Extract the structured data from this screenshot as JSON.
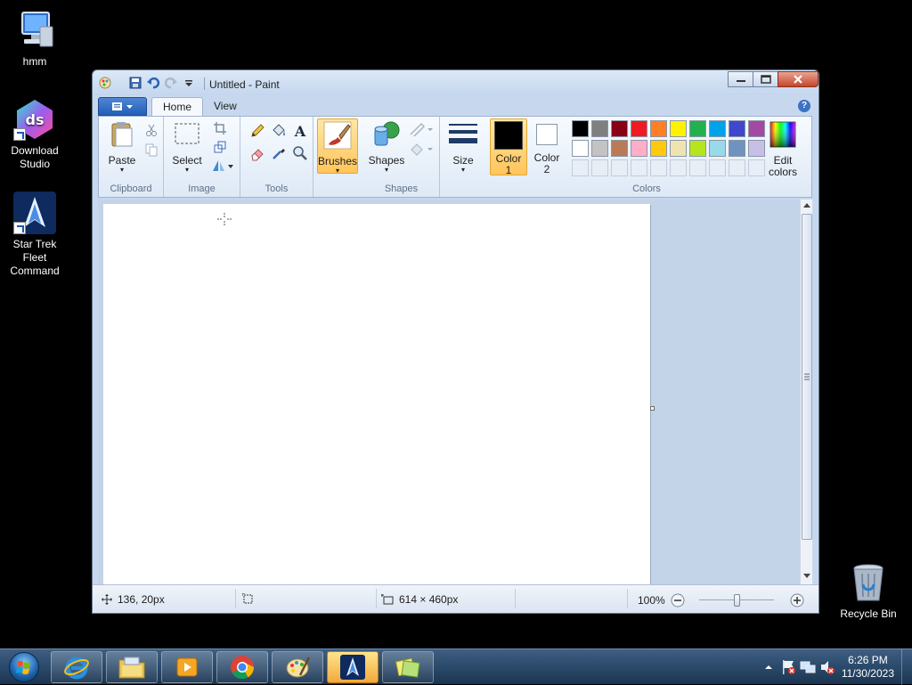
{
  "desktop": {
    "icons": [
      {
        "label": "hmm"
      },
      {
        "label": "Download Studio",
        "glyph_text": "ds"
      },
      {
        "label": "Star Trek Fleet Command"
      },
      {
        "label": "Recycle Bin"
      }
    ]
  },
  "window": {
    "title": "Untitled - Paint",
    "tabs": {
      "home": "Home",
      "view": "View"
    },
    "help": "?",
    "groups": {
      "clipboard": "Clipboard",
      "image": "Image",
      "tools": "Tools",
      "shapes": "Shapes",
      "colors": "Colors"
    },
    "buttons": {
      "paste": "Paste",
      "select": "Select",
      "brushes": "Brushes",
      "shapes": "Shapes",
      "size": "Size",
      "color1": "Color 1",
      "color2": "Color 2",
      "edit_colors": "Edit colors"
    },
    "current_colors": {
      "color1": "#000000",
      "color2": "#ffffff"
    },
    "palette": [
      [
        "#000000",
        "#7f7f7f",
        "#880015",
        "#ed1c24",
        "#ff7f27",
        "#fff200",
        "#22b14c",
        "#00a2e8",
        "#3f48cc",
        "#a349a4"
      ],
      [
        "#ffffff",
        "#c3c3c3",
        "#b97a57",
        "#ffaec9",
        "#ffc90e",
        "#efe4b0",
        "#b5e61d",
        "#99d9ea",
        "#7092be",
        "#c8bfe7"
      ]
    ],
    "status": {
      "cursor_pos": "136, 20px",
      "canvas_size": "614 × 460px",
      "zoom": "100%"
    }
  },
  "taskbar": {
    "clock_time": "6:26 PM",
    "clock_date": "11/30/2023"
  }
}
